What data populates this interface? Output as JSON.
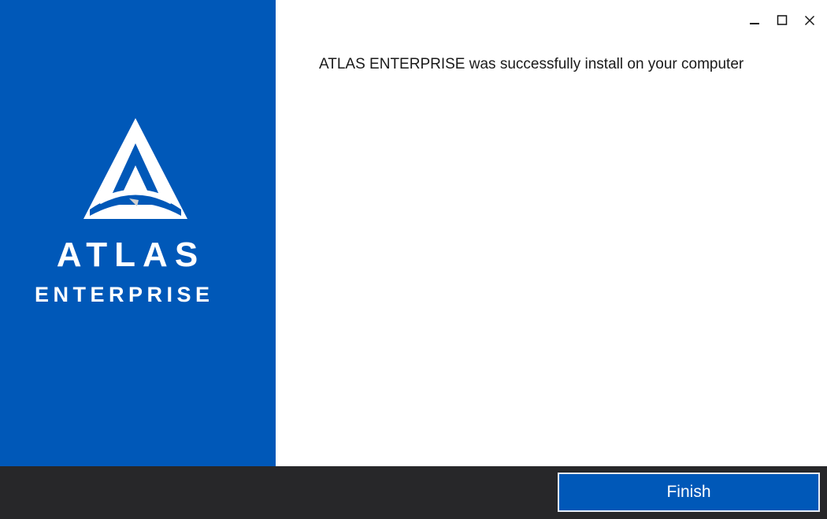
{
  "brand": {
    "name": "ATLAS",
    "edition": "ENTERPRISE",
    "logo_icon": "atlas-triangle-logo",
    "panel_color": "#0058b8"
  },
  "window_controls": {
    "minimize_icon": "minimize-icon",
    "maximize_icon": "maximize-icon",
    "close_icon": "close-icon"
  },
  "main": {
    "message": "ATLAS ENTERPRISE was successfully install on your computer"
  },
  "footer": {
    "finish_label": "Finish",
    "background_color": "#272729",
    "button_color": "#0058b8"
  }
}
